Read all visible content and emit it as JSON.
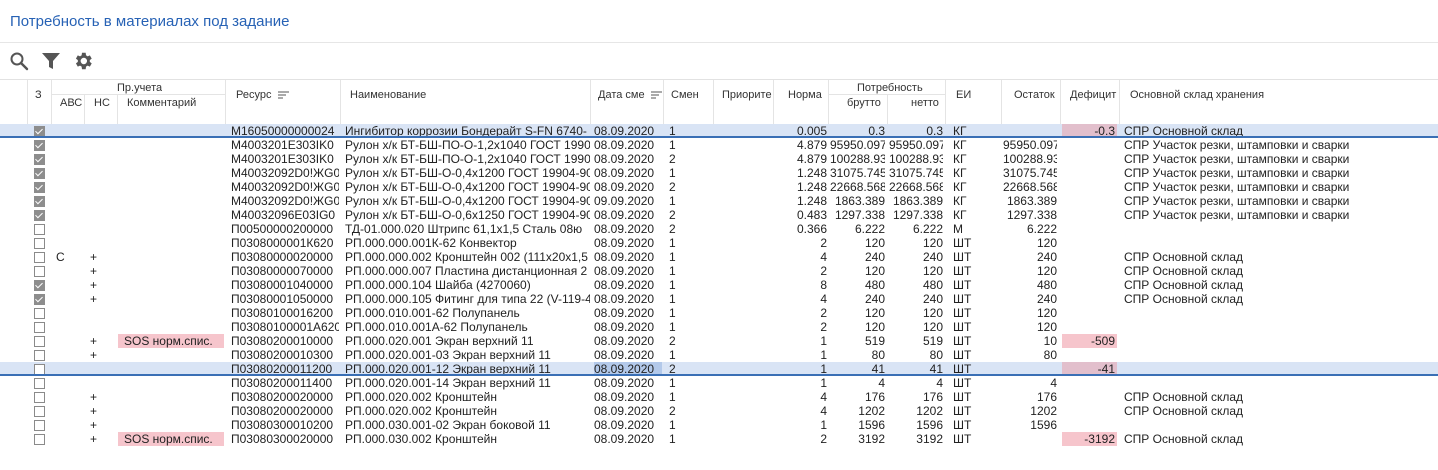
{
  "page": {
    "title": "Потребность в материалах под задание"
  },
  "toolbar": {
    "search_icon": "search-icon",
    "filter_icon": "filter-icon",
    "settings_icon": "gear-icon"
  },
  "columns": {
    "z": "З",
    "pr_ucheta": "Пр.учета",
    "abc": "АВС",
    "hc": "НС",
    "comment": "Комментарий",
    "resource": "Ресурс",
    "name": "Наименование",
    "date": "Дата сме",
    "shift": "Смен",
    "priority": "Приорите",
    "norm": "Норма",
    "need": "Потребность",
    "brutto": "брутто",
    "netto": "нетто",
    "ei": "ЕИ",
    "ostatok": "Остаток",
    "deficit": "Дефицит",
    "warehouse": "Основной склад хранения"
  },
  "colors": {
    "accent": "#2762b5",
    "deficit_pink": "#f6c5cc",
    "deficit_mauve": "#e2bfcc",
    "selection": "#d9e4f5"
  },
  "rows": [
    {
      "checked": true,
      "abc": "",
      "hc": "",
      "comment": "",
      "resource": "M16050000000024",
      "name": "Ингибитор коррозии Бондерайт S-FN 6740-",
      "date": "08.09.2020",
      "shift": "1",
      "norm": "0.005",
      "brutto": "0.3",
      "netto": "0.3",
      "ei": "КГ",
      "ostatok": "",
      "deficit": "-0.3",
      "warehouse": "СПР Основной склад"
    },
    {
      "checked": true,
      "abc": "",
      "hc": "",
      "comment": "",
      "resource": "M4003201E303IK0",
      "name": "Рулон х/к БТ-БШ-ПО-О-1,2х1040 ГОСТ 19904",
      "date": "08.09.2020",
      "shift": "1",
      "norm": "4.879",
      "brutto": "95950.097",
      "netto": "95950.097",
      "ei": "КГ",
      "ostatok": "95950.097",
      "deficit": "",
      "warehouse": "СПР Участок резки, штамповки и сварки"
    },
    {
      "checked": true,
      "abc": "",
      "hc": "",
      "comment": "",
      "resource": "M4003201E303IK0",
      "name": "Рулон х/к БТ-БШ-ПО-О-1,2х1040 ГОСТ 19904",
      "date": "08.09.2020",
      "shift": "2",
      "norm": "4.879",
      "brutto": "100288.931",
      "netto": "100288.931",
      "ei": "КГ",
      "ostatok": "100288.931",
      "deficit": "",
      "warehouse": "СПР Участок резки, штамповки и сварки"
    },
    {
      "checked": true,
      "abc": "",
      "hc": "",
      "comment": "",
      "resource": "M40032092D0!ЖG0",
      "name": "Рулон х/к БТ-БШ-О-0,4х1200 ГОСТ 19904-90",
      "date": "08.09.2020",
      "shift": "1",
      "norm": "1.248",
      "brutto": "31075.745",
      "netto": "31075.745",
      "ei": "КГ",
      "ostatok": "31075.745",
      "deficit": "",
      "warehouse": "СПР Участок резки, штамповки и сварки"
    },
    {
      "checked": true,
      "abc": "",
      "hc": "",
      "comment": "",
      "resource": "M40032092D0!ЖG0",
      "name": "Рулон х/к БТ-БШ-О-0,4х1200 ГОСТ 19904-90",
      "date": "08.09.2020",
      "shift": "2",
      "norm": "1.248",
      "brutto": "22668.568",
      "netto": "22668.568",
      "ei": "КГ",
      "ostatok": "22668.568",
      "deficit": "",
      "warehouse": "СПР Участок резки, штамповки и сварки"
    },
    {
      "checked": true,
      "abc": "",
      "hc": "",
      "comment": "",
      "resource": "M40032092D0!ЖG0",
      "name": "Рулон х/к БТ-БШ-О-0,4х1200 ГОСТ 19904-90",
      "date": "09.09.2020",
      "shift": "1",
      "norm": "1.248",
      "brutto": "1863.389",
      "netto": "1863.389",
      "ei": "КГ",
      "ostatok": "1863.389",
      "deficit": "",
      "warehouse": "СПР Участок резки, штамповки и сварки"
    },
    {
      "checked": true,
      "abc": "",
      "hc": "",
      "comment": "",
      "resource": "M40032096E03IG0",
      "name": "Рулон х/к БТ-БШ-О-0,6х1250 ГОСТ 19904-90",
      "date": "08.09.2020",
      "shift": "2",
      "norm": "0.483",
      "brutto": "1297.338",
      "netto": "1297.338",
      "ei": "КГ",
      "ostatok": "1297.338",
      "deficit": "",
      "warehouse": "СПР Участок резки, штамповки и сварки"
    },
    {
      "checked": false,
      "abc": "",
      "hc": "",
      "comment": "",
      "resource": "П00500000200000",
      "name": "ТД-01.000.020 Штрипс 61,1х1,5 Сталь 08ю",
      "date": "08.09.2020",
      "shift": "2",
      "norm": "0.366",
      "brutto": "6.222",
      "netto": "6.222",
      "ei": "М",
      "ostatok": "6.222",
      "deficit": "",
      "warehouse": ""
    },
    {
      "checked": false,
      "abc": "",
      "hc": "",
      "comment": "",
      "resource": "П0308000001К620",
      "name": "РП.000.000.001К-62 Конвектор",
      "date": "08.09.2020",
      "shift": "1",
      "norm": "2",
      "brutto": "120",
      "netto": "120",
      "ei": "ШТ",
      "ostatok": "120",
      "deficit": "",
      "warehouse": ""
    },
    {
      "checked": false,
      "abc": "C",
      "hc": "+",
      "comment": "",
      "resource": "П03080000020000",
      "name": "РП.000.000.002 Кронштейн 002 (111х20х1,5",
      "date": "08.09.2020",
      "shift": "1",
      "norm": "4",
      "brutto": "240",
      "netto": "240",
      "ei": "ШТ",
      "ostatok": "240",
      "deficit": "",
      "warehouse": "СПР Основной склад"
    },
    {
      "checked": false,
      "abc": "",
      "hc": "+",
      "comment": "",
      "resource": "П03080000070000",
      "name": "РП.000.000.007 Пластина дистанционная 2",
      "date": "08.09.2020",
      "shift": "1",
      "norm": "2",
      "brutto": "120",
      "netto": "120",
      "ei": "ШТ",
      "ostatok": "120",
      "deficit": "",
      "warehouse": "СПР Основной склад"
    },
    {
      "checked": true,
      "abc": "",
      "hc": "+",
      "comment": "",
      "resource": "П03080001040000",
      "name": "РП.000.000.104 Шайба (4270060)",
      "date": "08.09.2020",
      "shift": "1",
      "norm": "8",
      "brutto": "480",
      "netto": "480",
      "ei": "ШТ",
      "ostatok": "480",
      "deficit": "",
      "warehouse": "СПР Основной склад"
    },
    {
      "checked": true,
      "abc": "",
      "hc": "+",
      "comment": "",
      "resource": "П03080001050000",
      "name": "РП.000.000.105 Фитинг для типа 22 (V-119-4",
      "date": "08.09.2020",
      "shift": "1",
      "norm": "4",
      "brutto": "240",
      "netto": "240",
      "ei": "ШТ",
      "ostatok": "240",
      "deficit": "",
      "warehouse": "СПР Основной склад"
    },
    {
      "checked": false,
      "abc": "",
      "hc": "",
      "comment": "",
      "resource": "П03080100016200",
      "name": "РП.000.010.001-62 Полупанель",
      "date": "08.09.2020",
      "shift": "1",
      "norm": "2",
      "brutto": "120",
      "netto": "120",
      "ei": "ШТ",
      "ostatok": "120",
      "deficit": "",
      "warehouse": ""
    },
    {
      "checked": false,
      "abc": "",
      "hc": "",
      "comment": "",
      "resource": "П03080100001А620",
      "name": "РП.000.010.001А-62 Полупанель",
      "date": "08.09.2020",
      "shift": "1",
      "norm": "2",
      "brutto": "120",
      "netto": "120",
      "ei": "ШТ",
      "ostatok": "120",
      "deficit": "",
      "warehouse": ""
    },
    {
      "checked": false,
      "abc": "",
      "hc": "+",
      "comment": "SOS норм.спис.",
      "resource": "П03080200010000",
      "name": "РП.000.020.001 Экран верхний 11",
      "date": "08.09.2020",
      "shift": "2",
      "norm": "1",
      "brutto": "519",
      "netto": "519",
      "ei": "ШТ",
      "ostatok": "10",
      "deficit": "-509",
      "warehouse": ""
    },
    {
      "checked": false,
      "abc": "",
      "hc": "+",
      "comment": "",
      "resource": "П03080200010300",
      "name": "РП.000.020.001-03 Экран верхний 11",
      "date": "08.09.2020",
      "shift": "1",
      "norm": "1",
      "brutto": "80",
      "netto": "80",
      "ei": "ШТ",
      "ostatok": "80",
      "deficit": "",
      "warehouse": ""
    },
    {
      "checked": false,
      "abc": "",
      "hc": "",
      "comment": "",
      "resource": "П03080200011200",
      "name": "РП.000.020.001-12 Экран верхний 11",
      "date": "08.09.2020",
      "shift": "2",
      "norm": "1",
      "brutto": "41",
      "netto": "41",
      "ei": "ШТ",
      "ostatok": "",
      "deficit": "-41",
      "warehouse": "",
      "selected": true
    },
    {
      "checked": false,
      "abc": "",
      "hc": "",
      "comment": "",
      "resource": "П03080200011400",
      "name": "РП.000.020.001-14 Экран верхний 11",
      "date": "08.09.2020",
      "shift": "1",
      "norm": "1",
      "brutto": "4",
      "netto": "4",
      "ei": "ШТ",
      "ostatok": "4",
      "deficit": "",
      "warehouse": ""
    },
    {
      "checked": false,
      "abc": "",
      "hc": "+",
      "comment": "",
      "resource": "П03080200020000",
      "name": "РП.000.020.002 Кронштейн",
      "date": "08.09.2020",
      "shift": "1",
      "norm": "4",
      "brutto": "176",
      "netto": "176",
      "ei": "ШТ",
      "ostatok": "176",
      "deficit": "",
      "warehouse": "СПР Основной склад"
    },
    {
      "checked": false,
      "abc": "",
      "hc": "+",
      "comment": "",
      "resource": "П03080200020000",
      "name": "РП.000.020.002 Кронштейн",
      "date": "08.09.2020",
      "shift": "2",
      "norm": "4",
      "brutto": "1202",
      "netto": "1202",
      "ei": "ШТ",
      "ostatok": "1202",
      "deficit": "",
      "warehouse": "СПР Основной склад"
    },
    {
      "checked": false,
      "abc": "",
      "hc": "+",
      "comment": "",
      "resource": "П03080300010200",
      "name": "РП.000.030.001-02 Экран боковой 11",
      "date": "08.09.2020",
      "shift": "1",
      "norm": "1",
      "brutto": "1596",
      "netto": "1596",
      "ei": "ШТ",
      "ostatok": "1596",
      "deficit": "",
      "warehouse": ""
    },
    {
      "checked": false,
      "abc": "",
      "hc": "+",
      "comment": "SOS норм.спис.",
      "resource": "П03080300020000",
      "name": "РП.000.030.002 Кронштейн",
      "date": "08.09.2020",
      "shift": "1",
      "norm": "2",
      "brutto": "3192",
      "netto": "3192",
      "ei": "ШТ",
      "ostatok": "",
      "deficit": "-3192",
      "warehouse": "СПР Основной склад"
    }
  ]
}
